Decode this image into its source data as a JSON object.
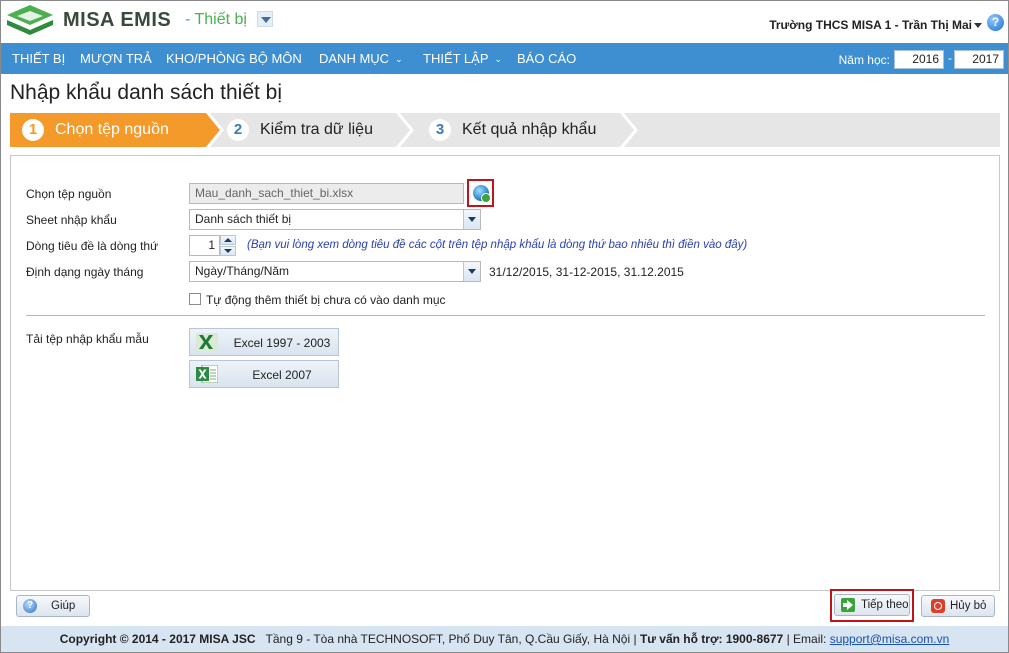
{
  "header": {
    "app_name": "MISA EMIS",
    "module_name": "- Thiết bị",
    "user_info": "Trường THCS MISA 1 - Trần Thị Mai"
  },
  "nav": {
    "items": [
      {
        "label": "THIẾT BỊ"
      },
      {
        "label": "MƯỢN TRẢ"
      },
      {
        "label": "KHO/PHÒNG BỘ MÔN"
      },
      {
        "label": "DANH MỤC",
        "has_dropdown": true
      },
      {
        "label": "THIẾT LẬP",
        "has_dropdown": true
      },
      {
        "label": "BÁO CÁO"
      }
    ],
    "school_year_label": "Năm học:",
    "year_from": "2016",
    "year_separator": "-",
    "year_to": "2017"
  },
  "page": {
    "title": "Nhập khẩu danh sách thiết bị"
  },
  "steps": [
    {
      "num": "1",
      "label": "Chọn tệp nguồn",
      "active": true
    },
    {
      "num": "2",
      "label": "Kiểm tra dữ liệu",
      "active": false
    },
    {
      "num": "3",
      "label": "Kết quả nhập khẩu",
      "active": false
    }
  ],
  "form": {
    "source_file_label": "Chọn tệp nguồn",
    "source_file_value": "Mau_danh_sach_thiet_bi.xlsx",
    "sheet_label": "Sheet nhập khẩu",
    "sheet_value": "Danh sách thiết bị",
    "header_row_label": "Dòng tiêu đề là dòng thứ",
    "header_row_value": "1",
    "header_row_hint": "(Bạn vui lòng xem dòng tiêu đề các cột trên tệp nhập khẩu là dòng thứ bao nhiêu thì điền vào đây)",
    "date_format_label": "Định dạng ngày tháng",
    "date_format_value": "Ngày/Tháng/Năm",
    "date_format_examples": "31/12/2015, 31-12-2015, 31.12.2015",
    "auto_add_label": "Tự động thêm thiết bị chưa có vào danh mục",
    "auto_add_checked": false,
    "template_label": "Tải tệp nhập khẩu mẫu",
    "excel_2003_label": "Excel 1997 - 2003",
    "excel_2007_label": "Excel 2007"
  },
  "buttons": {
    "help_label": "Giúp",
    "next_label": "Tiếp theo",
    "cancel_label": "Hủy bỏ"
  },
  "footer": {
    "copyright": "Copyright © 2014 - 2017 MISA JSC",
    "address": "Tầng 9 - Tòa nhà TECHNOSOFT, Phố Duy Tân, Q.Cầu Giấy, Hà Nội |",
    "hotline": "Tư vấn hỗ trợ: 1900-8677",
    "email_prefix": "| Email:",
    "email": "support@misa.com.vn"
  },
  "colors": {
    "nav_blue": "#3d8fd1",
    "step_orange": "#f39a2a",
    "highlight_red": "#c0141a",
    "brand_green": "#4caf50"
  }
}
